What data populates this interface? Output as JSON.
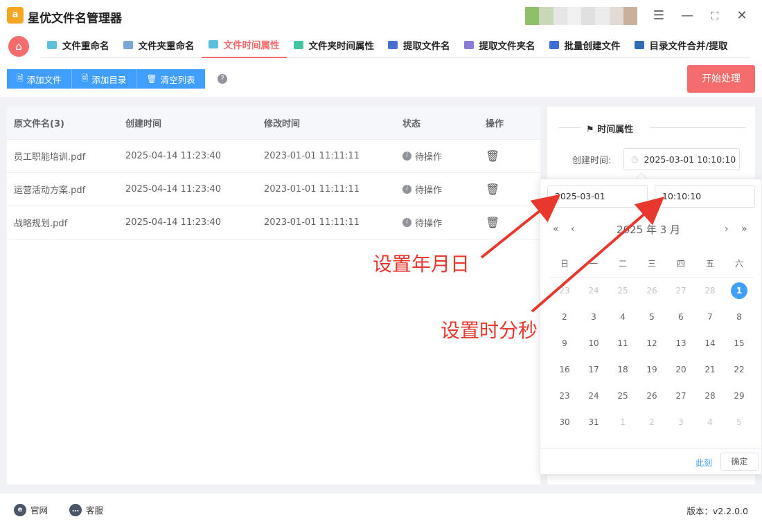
{
  "app": {
    "title": "星优文件名管理器",
    "logo_text": "a"
  },
  "window": {
    "settings_icon": "sliders-icon",
    "minimize": "—",
    "maximize": "⛶",
    "close": "✕"
  },
  "tabs": [
    {
      "label": "文件重命名",
      "color": "#5bc0de"
    },
    {
      "label": "文件夹重命名",
      "color": "#7aa7d8"
    },
    {
      "label": "文件时间属性",
      "color": "#5bc0de",
      "active": true
    },
    {
      "label": "文件夹时间属性",
      "color": "#44c4a1"
    },
    {
      "label": "提取文件名",
      "color": "#4a6fd1"
    },
    {
      "label": "提取文件夹名",
      "color": "#8a7bd8"
    },
    {
      "label": "批量创建文件",
      "color": "#3a6fd8"
    },
    {
      "label": "目录文件合并/提取",
      "color": "#2f6cb5"
    }
  ],
  "toolbar": {
    "add_file": "添加文件",
    "add_dir": "添加目录",
    "clear_list": "清空列表",
    "help": "?",
    "start": "开始处理"
  },
  "table": {
    "headers": [
      "原文件名(3)",
      "创建时间",
      "修改时间",
      "状态",
      "操作"
    ],
    "rows": [
      {
        "name": "员工职能培训.pdf",
        "created": "2025-04-14 11:23:40",
        "modified": "2023-01-01 11:11:11",
        "status": "待操作"
      },
      {
        "name": "运营活动方案.pdf",
        "created": "2025-04-14 11:23:40",
        "modified": "2023-01-01 11:11:11",
        "status": "待操作"
      },
      {
        "name": "战略规划.pdf",
        "created": "2025-04-14 11:23:40",
        "modified": "2023-01-01 11:11:11",
        "status": "待操作"
      }
    ]
  },
  "props": {
    "title": "时间属性",
    "created_label": "创建时间:",
    "created_value": "2025-03-01 10:10:10"
  },
  "picker": {
    "date_value": "2025-03-01",
    "time_value": "10:10:10",
    "year_month": "2025 年  3 月",
    "weekdays": [
      "日",
      "一",
      "二",
      "三",
      "四",
      "五",
      "六"
    ],
    "rows": [
      [
        "23",
        "24",
        "25",
        "26",
        "27",
        "28",
        "1"
      ],
      [
        "2",
        "3",
        "4",
        "5",
        "6",
        "7",
        "8"
      ],
      [
        "9",
        "10",
        "11",
        "12",
        "13",
        "14",
        "15"
      ],
      [
        "16",
        "17",
        "18",
        "19",
        "20",
        "21",
        "22"
      ],
      [
        "23",
        "24",
        "25",
        "26",
        "27",
        "28",
        "29"
      ],
      [
        "30",
        "31",
        "1",
        "2",
        "3",
        "4",
        "5"
      ]
    ],
    "selected_day": "1",
    "now": "此刻",
    "ok": "确定"
  },
  "annotations": {
    "set_date": "设置年月日",
    "set_time": "设置时分秒",
    "color": "#e8382d"
  },
  "footer": {
    "website": "官网",
    "support": "客服",
    "version": "版本：v2.2.0.0"
  }
}
